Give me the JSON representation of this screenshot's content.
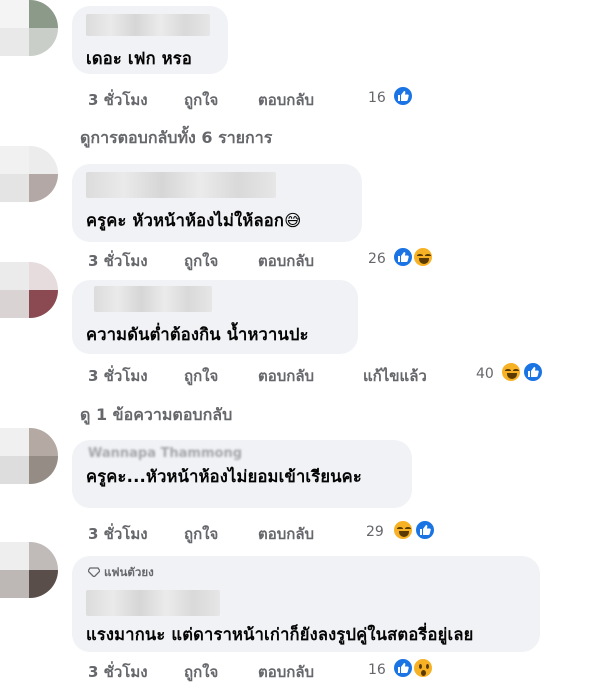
{
  "comments": [
    {
      "text": "เดอะ เฟก หรอ",
      "time": "3 ชั่วโมง",
      "like_label": "ถูกใจ",
      "reply_label": "ตอบกลับ",
      "edited": "",
      "reaction_count": "16",
      "reactions": [
        "like-icon"
      ]
    },
    {
      "text": "ครูคะ หัวหน้าห้องไม่ให้ลอก😅",
      "time": "3 ชั่วโมง",
      "like_label": "ถูกใจ",
      "reply_label": "ตอบกลับ",
      "edited": "",
      "reaction_count": "26",
      "reactions": [
        "like-icon",
        "haha-icon"
      ]
    },
    {
      "text": "ความดันต่ำต้องกิน น้ำหวานปะ",
      "time": "3 ชั่วโมง",
      "like_label": "ถูกใจ",
      "reply_label": "ตอบกลับ",
      "edited": "แก้ไขแล้ว",
      "reaction_count": "40",
      "reactions": [
        "haha-icon",
        "like-icon"
      ]
    },
    {
      "text": "ครูคะ...หัวหน้าห้องไม่ยอมเข้าเรียนคะ",
      "time": "3 ชั่วโมง",
      "like_label": "ถูกใจ",
      "reply_label": "ตอบกลับ",
      "edited": "",
      "reaction_count": "29",
      "reactions": [
        "haha-icon",
        "like-icon"
      ]
    },
    {
      "badge": "แฟนตัวยง",
      "text": "แรงมากนะ แต่ดาราหน้าเก่าก็ยังลงรูปคู่ในสตอรี่อยู่เลย",
      "time": "3 ชั่วโมง",
      "like_label": "ถูกใจ",
      "reply_label": "ตอบกลับ",
      "edited": "",
      "reaction_count": "16",
      "reactions": [
        "like-icon",
        "wow-icon"
      ]
    }
  ],
  "view_replies": [
    {
      "label": "ดูการตอบกลับทั้ง 6 รายการ"
    },
    {
      "label": "ดู 1 ข้อความตอบกลับ"
    }
  ],
  "colors": {
    "bubble": "#f0f2f5",
    "meta_text": "#65676b",
    "like": "#1b74e4",
    "haha": "#f7b125"
  }
}
